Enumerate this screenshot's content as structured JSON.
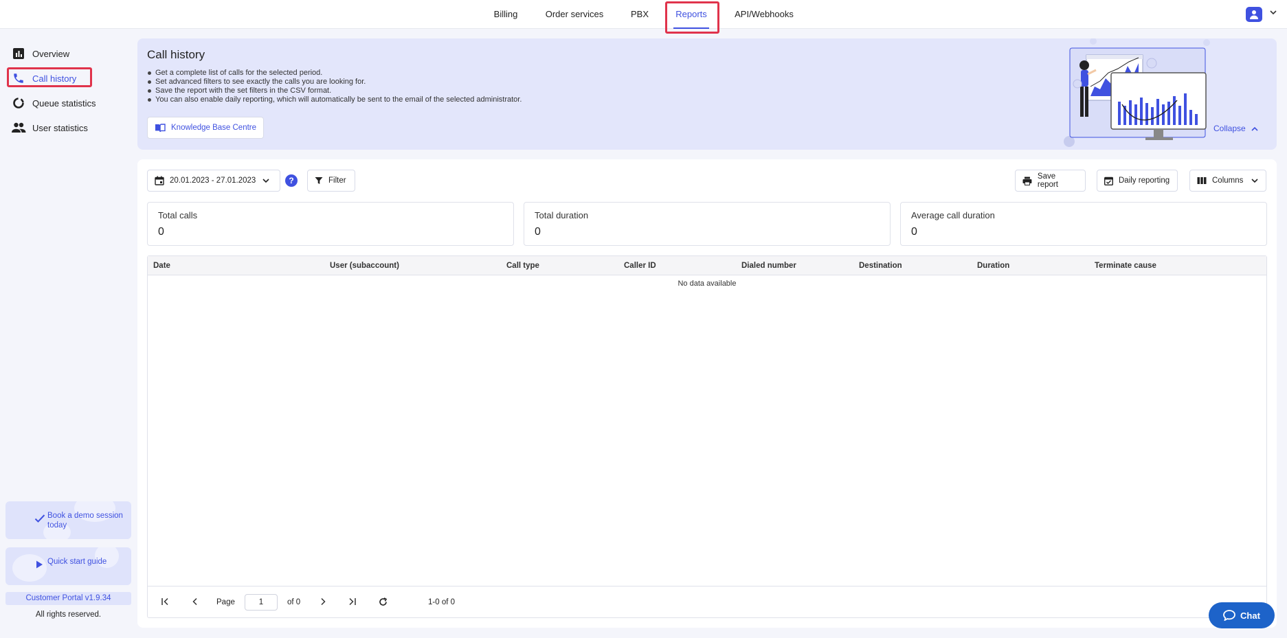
{
  "topnav": {
    "items": [
      {
        "label": "Billing"
      },
      {
        "label": "Order services"
      },
      {
        "label": "PBX"
      },
      {
        "label": "Reports",
        "active": true
      },
      {
        "label": "API/Webhooks"
      }
    ]
  },
  "sidebar": {
    "items": [
      {
        "label": "Overview",
        "icon": "bar-chart-icon"
      },
      {
        "label": "Call history",
        "icon": "phone-icon",
        "active": true
      },
      {
        "label": "Queue statistics",
        "icon": "donut-chart-icon"
      },
      {
        "label": "User statistics",
        "icon": "users-icon"
      }
    ],
    "promo_demo": "Book a demo session today",
    "promo_guide": "Quick start guide",
    "version": "Customer Portal v1.9.34",
    "rights": "All rights reserved."
  },
  "banner": {
    "title": "Call history",
    "bullets": [
      "Get a complete list of calls for the selected period.",
      "Set advanced filters to see exactly the calls you are looking for.",
      "Save the report with the set filters in the CSV format.",
      "You can also enable daily reporting, which will automatically be sent to the email of the selected administrator."
    ],
    "kb_button": "Knowledge Base Centre",
    "collapse": "Collapse"
  },
  "toolbar": {
    "date_range": "20.01.2023 - 27.01.2023",
    "help": "?",
    "filter": "Filter",
    "save_report": "Save report",
    "daily_reporting": "Daily reporting",
    "columns": "Columns"
  },
  "stats": [
    {
      "label": "Total calls",
      "value": "0"
    },
    {
      "label": "Total duration",
      "value": "0"
    },
    {
      "label": "Average call duration",
      "value": "0"
    }
  ],
  "table": {
    "columns": [
      "Date",
      "User (subaccount)",
      "Call type",
      "Caller ID",
      "Dialed number",
      "Destination",
      "Duration",
      "Terminate cause"
    ],
    "empty_text": "No data available"
  },
  "pager": {
    "page_label": "Page",
    "page_value": "1",
    "of_label": "of 0",
    "range": "1-0 of 0"
  },
  "chat": {
    "label": "Chat"
  },
  "colors": {
    "accent": "#3f51e0",
    "highlight": "#e0334b",
    "chat": "#1d63c9"
  }
}
